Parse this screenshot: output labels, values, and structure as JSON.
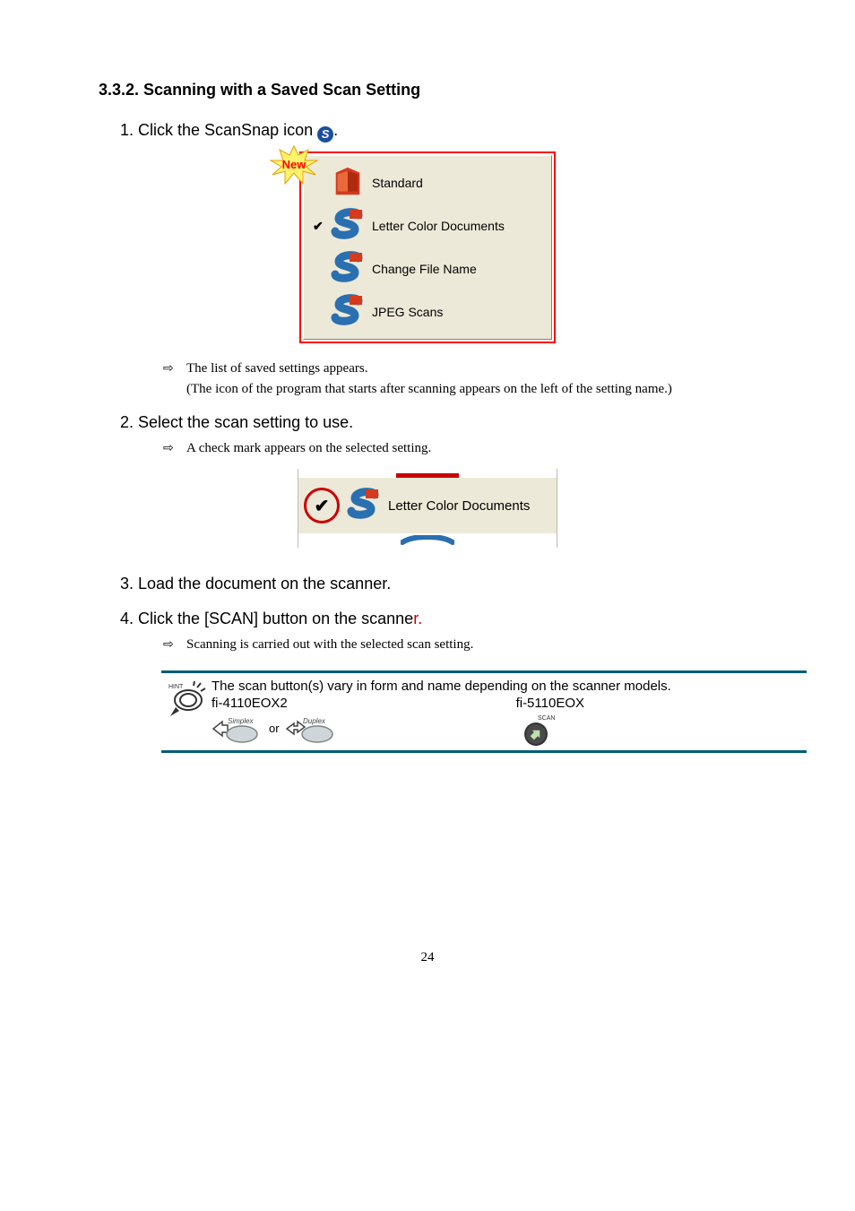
{
  "heading": "3.3.2. Scanning with a Saved Scan Setting",
  "step1_prefix": "1.  Click the ScanSnap icon ",
  "step1_suffix": ".",
  "scansnap_icon_letter": "S",
  "menu": {
    "new_burst": "New",
    "items": [
      {
        "label": "Standard",
        "checked": false,
        "iconKind": "p"
      },
      {
        "label": "Letter Color Documents",
        "checked": true,
        "iconKind": "s"
      },
      {
        "label": "Change File Name",
        "checked": false,
        "iconKind": "s"
      },
      {
        "label": "JPEG Scans",
        "checked": false,
        "iconKind": "s"
      }
    ]
  },
  "sub1a": "The list of saved settings appears.",
  "sub1b": "(The icon of the program that starts after scanning appears on the left of the setting name.)",
  "step2": "2.  Select the scan setting to use.",
  "sub2": "A check mark appears on the selected setting.",
  "selected_label": "Letter Color Documents",
  "step3": "3.  Load the document on the scanner.",
  "step4_black": "4.  Click the [SCAN] button on the scanne",
  "step4_red": "r.",
  "sub4": "Scanning is carried out with the selected scan setting.",
  "hint": {
    "icon_label": "HINT",
    "line1": "The scan button(s) vary in form and name depending on the scanner models.",
    "model_a": "fi-4110EOX2",
    "model_b": "fi-5110EOX",
    "simplex": "Simplex",
    "duplex": "Duplex",
    "or": "or",
    "scan": "SCAN"
  },
  "page_number": "24"
}
